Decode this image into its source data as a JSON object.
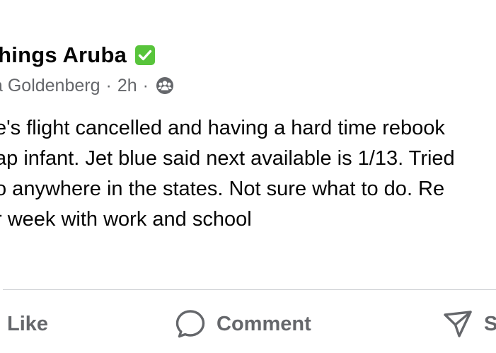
{
  "post": {
    "group_name": "Things Aruba",
    "verified_icon": "check-square-icon",
    "author": "a Goldenberg",
    "separator": "·",
    "time": "2h",
    "audience_icon": "group-audience-icon",
    "lines": [
      "e's flight cancelled and having a hard time rebook",
      "ap infant. Jet blue said next available is 1/13. Tried",
      "o anywhere in the states. Not sure what to do. Re",
      "r week with work and school"
    ]
  },
  "actions": {
    "like_label": "Like",
    "comment_label": "Comment",
    "share_label": "S"
  },
  "colors": {
    "text_primary": "#050505",
    "text_secondary": "#65676b",
    "verified_green": "#58c43b",
    "divider": "#ced0d4"
  }
}
